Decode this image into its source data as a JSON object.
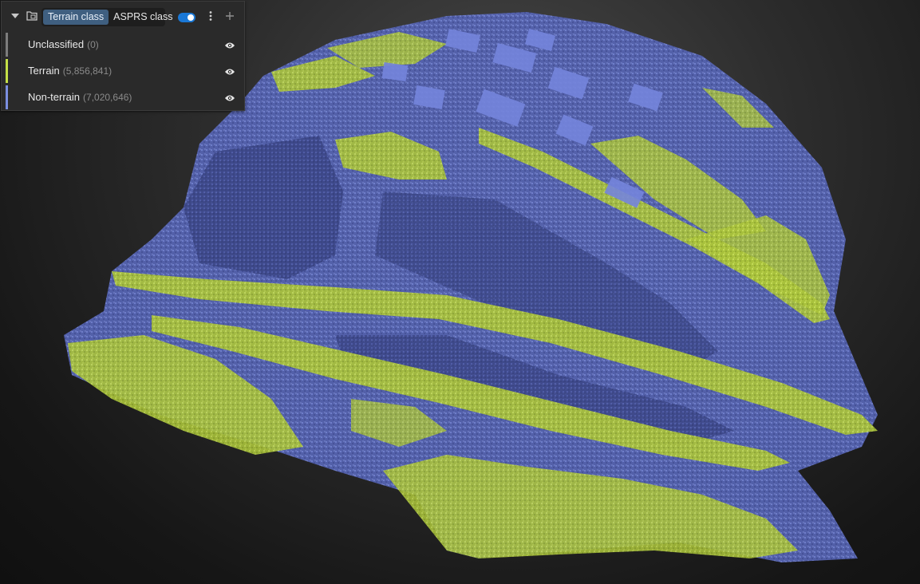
{
  "panel": {
    "tabs": [
      {
        "label": "Terrain class",
        "active": true
      },
      {
        "label": "ASPRS class",
        "active": false
      }
    ],
    "toggle_on": true,
    "classes": [
      {
        "label": "Unclassified",
        "count": "(0)",
        "color": "#7d7d7d"
      },
      {
        "label": "Terrain",
        "count": "(5,856,841)",
        "color": "#c5e047"
      },
      {
        "label": "Non-terrain",
        "count": "(7,020,646)",
        "color": "#7b8fe0"
      }
    ]
  },
  "icons": {
    "collapse": "chevron-down-icon",
    "folder": "folder-icon",
    "toggle": "toggle-icon",
    "more": "more-vertical-icon",
    "add": "plus-icon",
    "visibility": "eye-icon"
  },
  "viewport": {
    "terrain_color": "#c5e047",
    "nonterrain_color": "#6f7fd6",
    "background": "#151515"
  }
}
